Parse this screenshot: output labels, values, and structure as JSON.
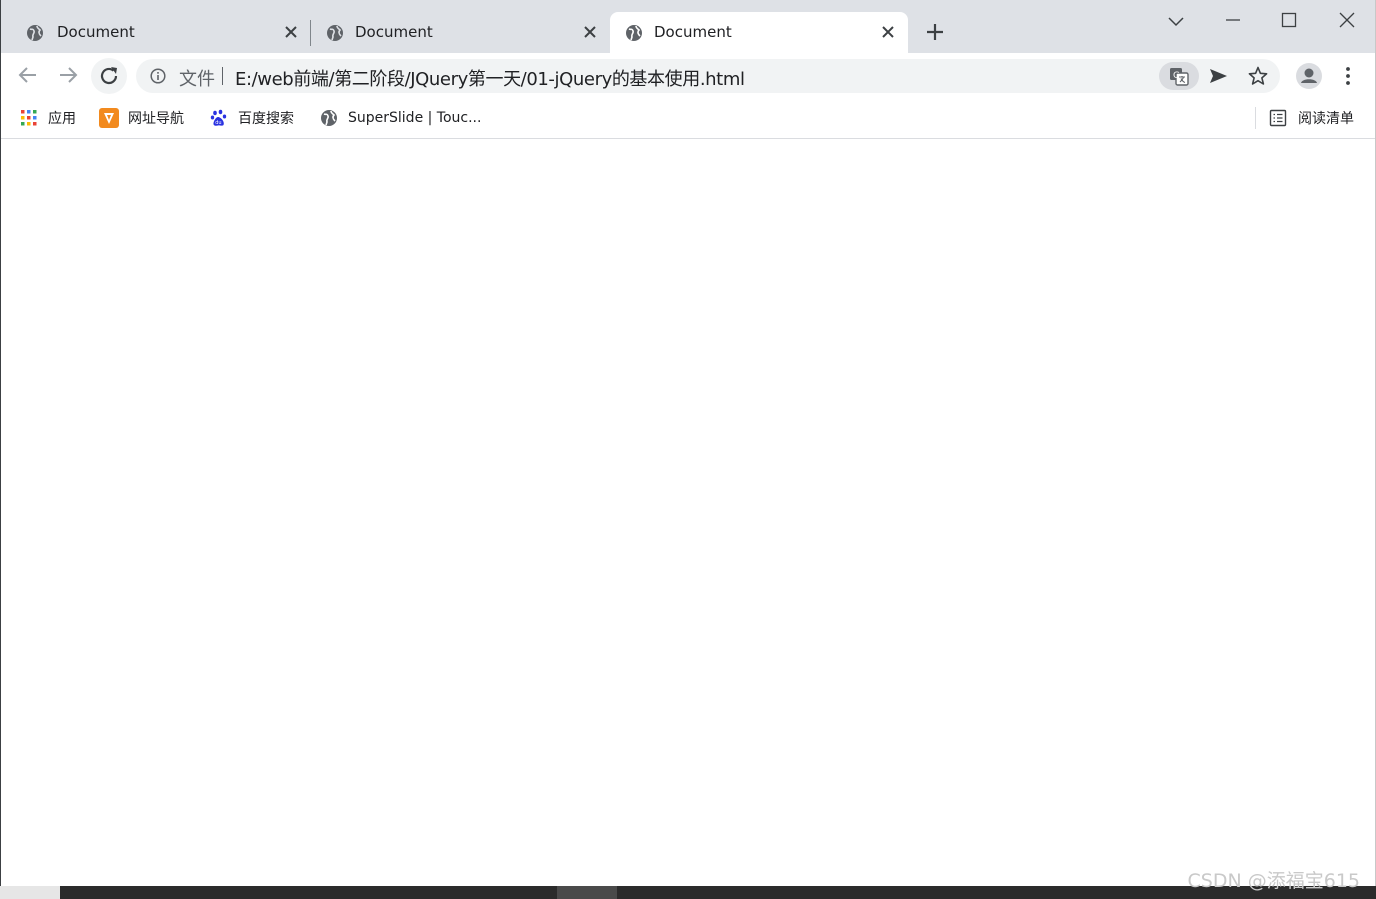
{
  "tabs": [
    {
      "title": "Document",
      "active": false
    },
    {
      "title": "Document",
      "active": false
    },
    {
      "title": "Document",
      "active": true
    }
  ],
  "toolbar": {
    "scheme_label": "文件",
    "url": "E:/web前端/第二阶段/JQuery第一天/01-jQuery的基本使用.html"
  },
  "bookmarks": {
    "items": [
      {
        "label": "应用",
        "icon": "apps-grid-icon"
      },
      {
        "label": "网址导航",
        "icon": "nav-arrow-icon"
      },
      {
        "label": "百度搜索",
        "icon": "baidu-paw-icon"
      },
      {
        "label": "SuperSlide | Touc...",
        "icon": "globe-icon"
      }
    ],
    "reading_list_label": "阅读清单"
  },
  "watermark": "CSDN @添福宝615",
  "colors": {
    "tabstrip_bg": "#dee1e6",
    "omnibox_bg": "#f1f3f4",
    "icon_gray": "#5f6368",
    "text_dark": "#202124"
  }
}
